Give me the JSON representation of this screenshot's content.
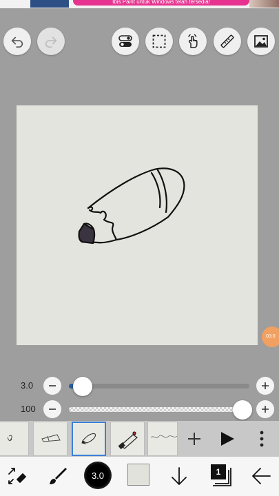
{
  "banner": {
    "ad_text": "Ibis Paint untuk Windows telah tersedia!"
  },
  "toolbar": {
    "undo_icon": "undo-icon",
    "redo_icon": "redo-icon",
    "icons": [
      "toggle-icon",
      "selection-icon",
      "hand-gesture-icon",
      "ruler-icon",
      "image-icon"
    ]
  },
  "canvas": {
    "background_color": "#e4e4de",
    "drawing": "pencil-sketch"
  },
  "floating_badge": {
    "text": "00:0"
  },
  "brush_size_slider": {
    "value_label": "3.0",
    "value": 3.0,
    "fraction": 0.07
  },
  "opacity_slider": {
    "value_label": "100",
    "value": 100,
    "fraction": 1.0
  },
  "layers": {
    "count": 5,
    "selected_index": 2,
    "add_label": "+",
    "play_icon": "play-icon",
    "more_icon": "more-vertical-icon"
  },
  "bottom_bar": {
    "brush_size_label": "3.0",
    "layer_count": "1",
    "current_color": "#e2e2dc"
  }
}
